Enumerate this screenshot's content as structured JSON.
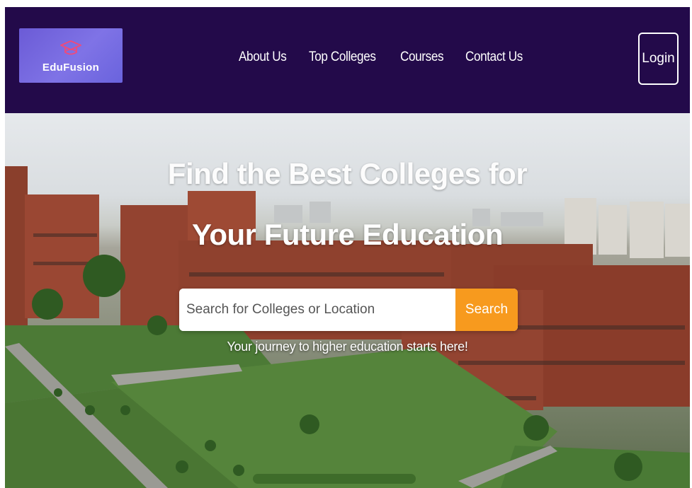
{
  "brand": {
    "name": "EduFusion",
    "icon": "graduation-cap-icon",
    "bg": "#6f63dc"
  },
  "nav": {
    "links": [
      "About Us",
      "Top Colleges",
      "Courses",
      "Contact Us"
    ],
    "login_label": "Login",
    "bg": "#230a4a"
  },
  "hero": {
    "title_line1": "Find the Best Colleges for",
    "title_line2": "Your Future Education",
    "search_placeholder": "Search for Colleges or Location",
    "search_button": "Search",
    "tagline": "Your journey to higher education starts here!",
    "accent": "#f79a1e"
  }
}
